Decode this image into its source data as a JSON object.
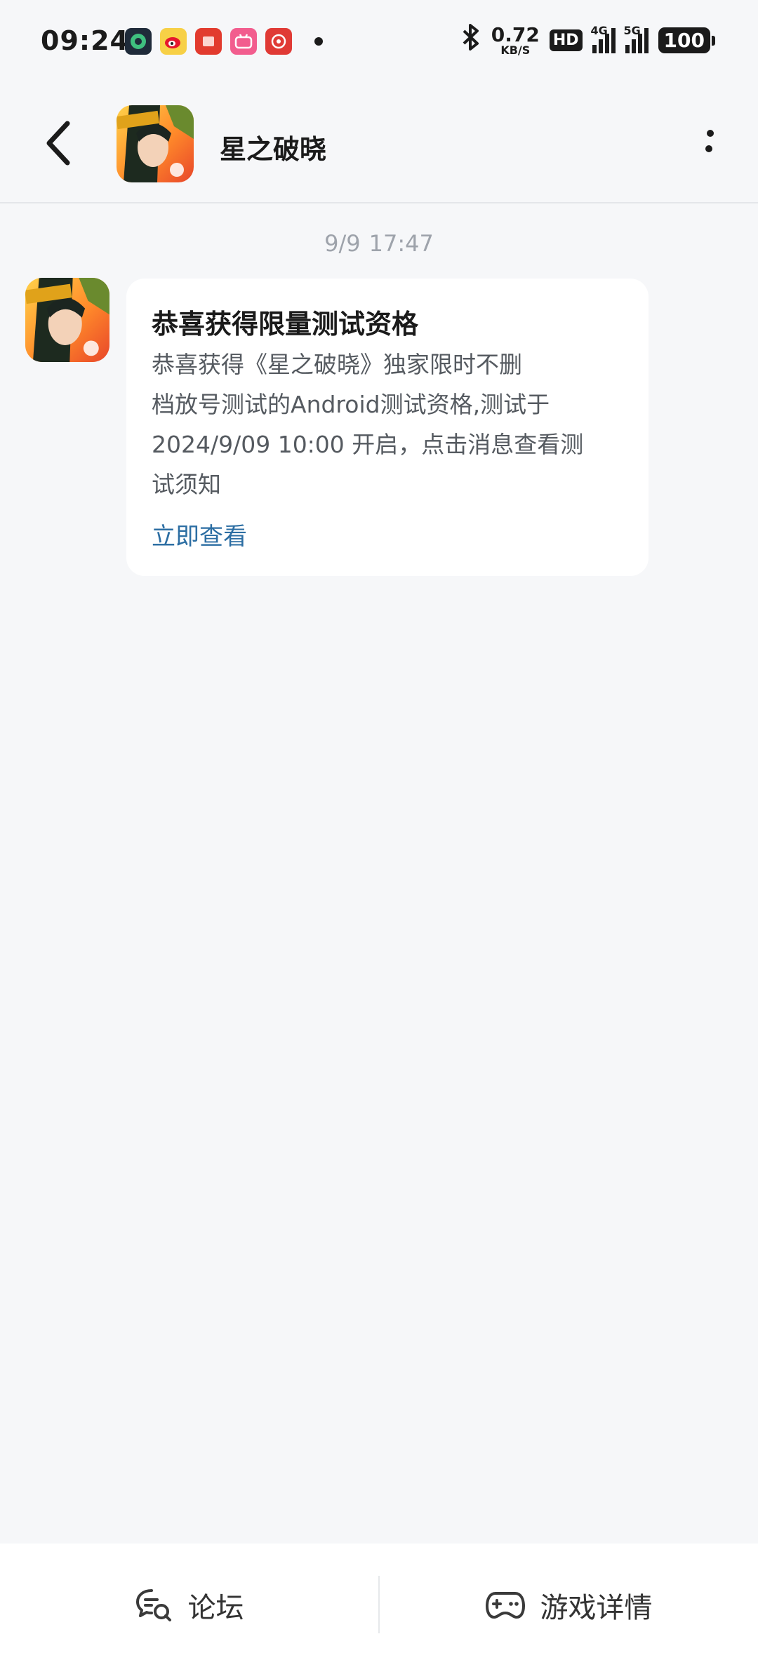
{
  "status_bar": {
    "time": "09:24",
    "net_speed_value": "0.72",
    "net_speed_unit": "KB/S",
    "hd_label": "HD",
    "sim1_label": "4G",
    "sim2_label": "5G",
    "battery": "100",
    "notification_icons": [
      "app-icon-1",
      "weibo-icon",
      "app-icon-3",
      "bilibili-icon",
      "app-icon-5"
    ]
  },
  "header": {
    "title": "星之破晓"
  },
  "chat": {
    "date": "9/9",
    "time": "17:47",
    "message": {
      "title": "恭喜获得限量测试资格",
      "body_lines": [
        "恭喜获得《星之破晓》独家限时不删",
        "档放号测试的Android测试资格,测试于",
        "2024/9/09 10:00 开启，点击消息查看测",
        "试须知"
      ],
      "link": "立即查看"
    }
  },
  "bottom_bar": {
    "forum_label": "论坛",
    "game_details_label": "游戏详情"
  },
  "colors": {
    "background": "#f6f7f9",
    "link": "#2c6ea3",
    "timestamp": "#9ea3ab"
  }
}
